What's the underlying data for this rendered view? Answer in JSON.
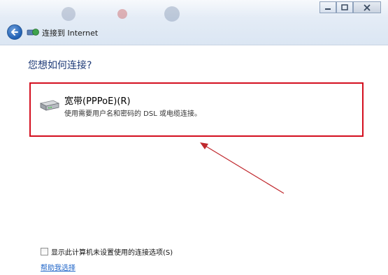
{
  "window": {
    "nav_title": "连接到 Internet"
  },
  "page": {
    "question": "您想如何连接?",
    "options": [
      {
        "title": "宽带(PPPoE)(R)",
        "description": "使用需要用户名和密码的 DSL 或电缆连接。",
        "icon": "broadband-modem-icon"
      }
    ]
  },
  "footer": {
    "checkbox_label": "显示此计算机未设置使用的连接选项(S)",
    "checkbox_checked": false,
    "help_link": "帮助我选择"
  },
  "colors": {
    "highlight_border": "#d40f1f",
    "arrow": "#c0282d",
    "question_text": "#1f3b78",
    "link": "#1e64c8"
  }
}
